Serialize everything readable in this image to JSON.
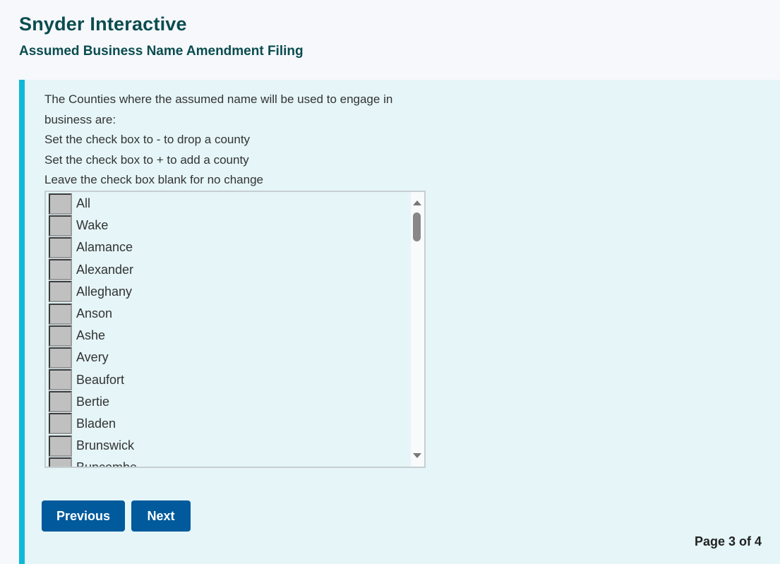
{
  "header": {
    "app_title": "Snyder Interactive",
    "form_title": "Assumed Business Name Amendment Filing"
  },
  "instructions": [
    "The Counties where the assumed name will be used to engage in business are:",
    "Set the check box to - to drop a county",
    "Set the check box to + to add a county",
    "Leave the check box blank for no change"
  ],
  "county_list": {
    "items": [
      {
        "label": "All",
        "state": ""
      },
      {
        "label": "Wake",
        "state": ""
      },
      {
        "label": "Alamance",
        "state": ""
      },
      {
        "label": "Alexander",
        "state": ""
      },
      {
        "label": "Alleghany",
        "state": ""
      },
      {
        "label": "Anson",
        "state": ""
      },
      {
        "label": "Ashe",
        "state": ""
      },
      {
        "label": "Avery",
        "state": ""
      },
      {
        "label": "Beaufort",
        "state": ""
      },
      {
        "label": "Bertie",
        "state": ""
      },
      {
        "label": "Bladen",
        "state": ""
      },
      {
        "label": "Brunswick",
        "state": ""
      },
      {
        "label": "Buncombe",
        "state": ""
      }
    ]
  },
  "buttons": {
    "previous": "Previous",
    "next": "Next"
  },
  "pagination": {
    "label": "Page 3 of 4",
    "current": 3,
    "total": 4
  },
  "colors": {
    "accent_bar": "#10b8d8",
    "button": "#005a9c",
    "title": "#0a4c4f",
    "panel_bg": "#e5f5f8"
  }
}
